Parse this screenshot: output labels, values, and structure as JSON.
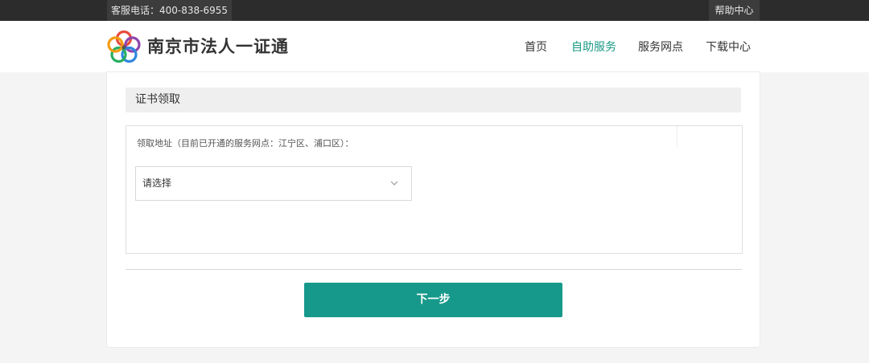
{
  "topbar": {
    "hotline": "客服电话：400-838-6955",
    "help_link": "帮助中心"
  },
  "header": {
    "site_title": "南京市法人一证通",
    "nav": [
      {
        "label": "首页",
        "active": false
      },
      {
        "label": "自助服务",
        "active": true
      },
      {
        "label": "服务网点",
        "active": false
      },
      {
        "label": "下载中心",
        "active": false
      }
    ]
  },
  "section": {
    "title": "证书领取"
  },
  "form": {
    "pickup_label": "领取地址（目前已开通的服务网点：江宁区、浦口区）：",
    "pickup_select_value": "请选择"
  },
  "actions": {
    "next_label": "下一步"
  },
  "colors": {
    "accent": "#16998a",
    "topbar_bg": "#2c2c2c",
    "page_bg": "#f4f4f4"
  },
  "icons": {
    "logo": "plum-blossom-logo",
    "select_arrow": "chevron-down-icon"
  }
}
